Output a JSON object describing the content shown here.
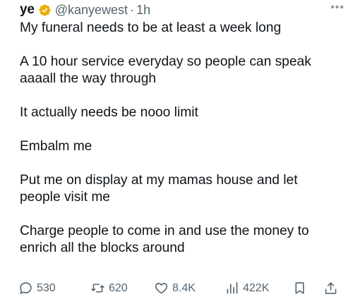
{
  "tweet": {
    "display_name": "ye",
    "handle": "@kanyewest",
    "separator": "·",
    "time": "1h",
    "more_icon": "more-horizontal-icon",
    "verified_color": "#e8b00a",
    "paragraphs": [
      "My funeral needs to be at least a week long",
      "A 10 hour service everyday so people can speak aaaall the way through",
      "It actually needs be nooo limit",
      "Embalm me",
      "Put me on display at my mamas house and let people visit me",
      "Charge people to come in and use the money to enrich all the blocks around"
    ]
  },
  "actions": {
    "reply_count": "530",
    "repost_count": "620",
    "like_count": "8.4K",
    "views_count": "422K",
    "icons": [
      "reply-icon",
      "repost-icon",
      "like-icon",
      "views-icon",
      "bookmark-icon",
      "share-icon"
    ]
  }
}
